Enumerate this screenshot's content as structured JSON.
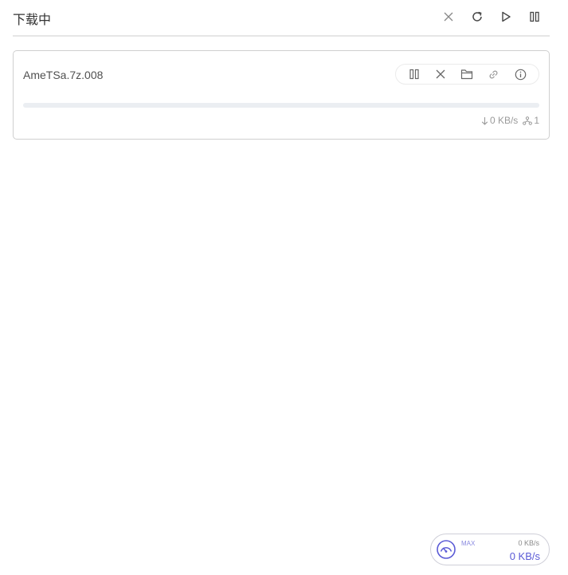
{
  "header": {
    "title": "下载中",
    "actions": [
      {
        "name": "clear-button",
        "icon": "close-icon"
      },
      {
        "name": "refresh-button",
        "icon": "refresh-icon"
      },
      {
        "name": "resume-all-button",
        "icon": "play-icon"
      },
      {
        "name": "pause-all-button",
        "icon": "pause-icon"
      }
    ]
  },
  "task": {
    "name": "AmeTSa.7z.008",
    "progress": 0,
    "download_speed": "0 KB/s",
    "connections": "1",
    "actions": [
      {
        "name": "pause-task-button",
        "icon": "pause-icon"
      },
      {
        "name": "delete-task-button",
        "icon": "close-icon"
      },
      {
        "name": "open-folder-button",
        "icon": "folder-icon"
      },
      {
        "name": "copy-link-button",
        "icon": "link-icon"
      },
      {
        "name": "task-info-button",
        "icon": "info-icon"
      }
    ]
  },
  "speedometer": {
    "mode": "MAX",
    "upload_speed": "0 KB/s",
    "download_speed": "0 KB/s"
  },
  "colors": {
    "accent": "#5b5bd6",
    "border": "#cfcfcf",
    "muted_text": "#9a9a9a",
    "icon": "#555555"
  }
}
